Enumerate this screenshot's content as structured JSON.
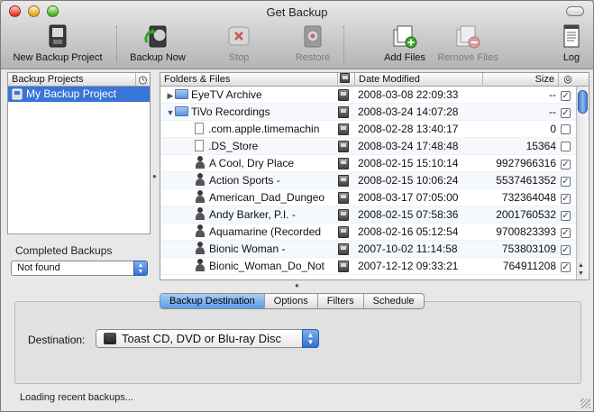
{
  "window": {
    "title": "Get Backup"
  },
  "toolbar": {
    "new_backup_project": "New Backup Project",
    "backup_now": "Backup Now",
    "stop": "Stop",
    "restore": "Restore",
    "add_files": "Add Files",
    "remove_files": "Remove Files",
    "log": "Log"
  },
  "projects": {
    "header": "Backup Projects",
    "items": [
      "My Backup Project"
    ]
  },
  "completed": {
    "label": "Completed Backups",
    "selected": "Not found"
  },
  "files": {
    "columns": {
      "name": "Folders & Files",
      "date": "Date Modified",
      "size": "Size"
    },
    "rows": [
      {
        "name": "EyeTV Archive",
        "date": "2008-03-08 22:09:33",
        "size": "--",
        "checked": true
      },
      {
        "name": "TiVo Recordings",
        "date": "2008-03-24 14:07:28",
        "size": "--",
        "checked": true
      },
      {
        "name": ".com.apple.timemachin",
        "date": "2008-02-28 13:40:17",
        "size": "0",
        "checked": false
      },
      {
        "name": ".DS_Store",
        "date": "2008-03-24 17:48:48",
        "size": "15364",
        "checked": false
      },
      {
        "name": "A Cool, Dry Place",
        "date": "2008-02-15 15:10:14",
        "size": "9927966316",
        "checked": true
      },
      {
        "name": "Action Sports -",
        "date": "2008-02-15 10:06:24",
        "size": "5537461352",
        "checked": true
      },
      {
        "name": "American_Dad_Dungeo",
        "date": "2008-03-17 07:05:00",
        "size": "732364048",
        "checked": true
      },
      {
        "name": "Andy Barker, P.I. -",
        "date": "2008-02-15 07:58:36",
        "size": "2001760532",
        "checked": true
      },
      {
        "name": "Aquamarine (Recorded",
        "date": "2008-02-16 05:12:54",
        "size": "9700823393",
        "checked": true
      },
      {
        "name": "Bionic Woman -",
        "date": "2007-10-02 11:14:58",
        "size": "753803109",
        "checked": true
      },
      {
        "name": "Bionic_Woman_Do_Not",
        "date": "2007-12-12 09:33:21",
        "size": "764911208",
        "checked": true
      }
    ]
  },
  "tabs": [
    "Backup Destination",
    "Options",
    "Filters",
    "Schedule"
  ],
  "destination": {
    "label": "Destination:",
    "selected": "Toast CD, DVD or Blu-ray Disc"
  },
  "status": "Loading recent backups..."
}
